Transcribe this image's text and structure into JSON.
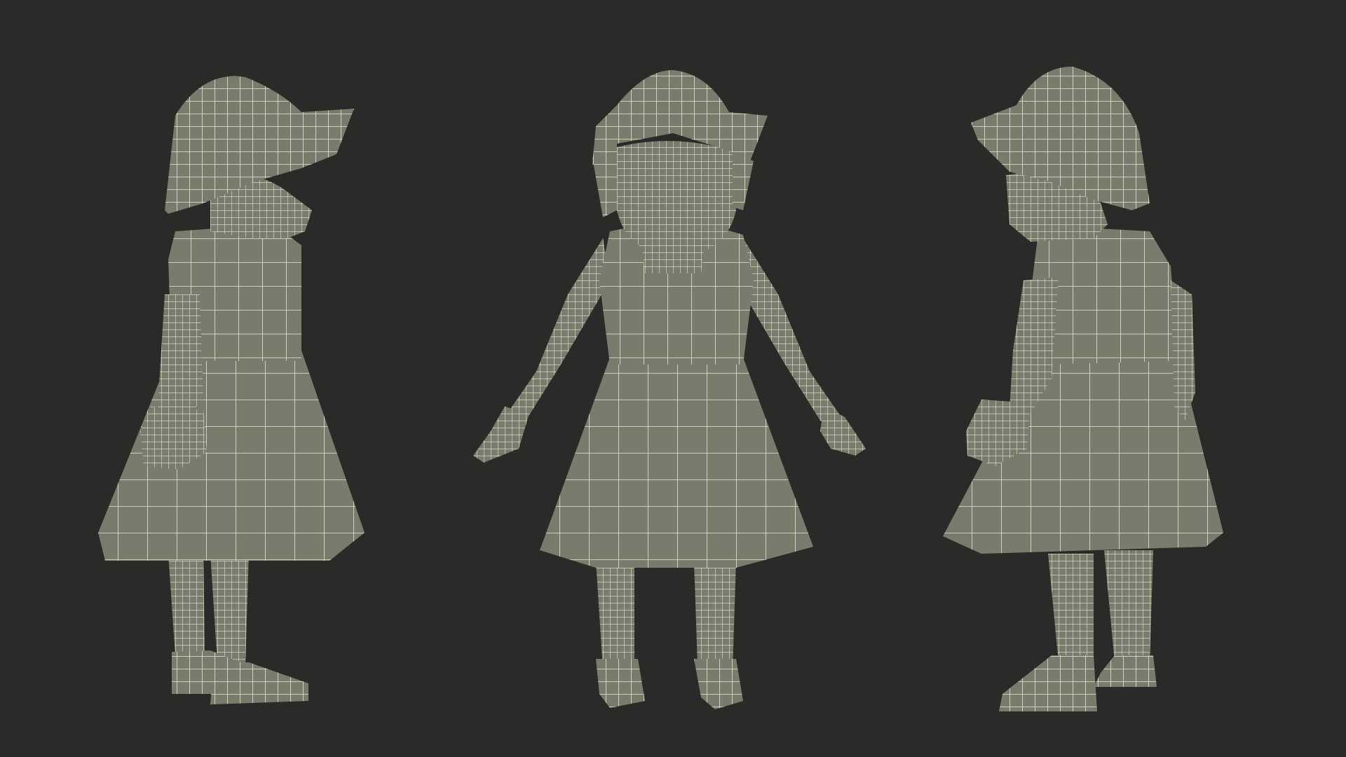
{
  "scene": {
    "background_color": "#2b2a28",
    "mesh_fill_color": "#7a7b6c",
    "mesh_shadow_color": "#636455",
    "wire_color": "#e9e6cf",
    "views": [
      {
        "name": "side-view-right-facing",
        "facing": "right"
      },
      {
        "name": "front-view",
        "facing": "front"
      },
      {
        "name": "side-view-left-facing",
        "facing": "left"
      }
    ]
  }
}
